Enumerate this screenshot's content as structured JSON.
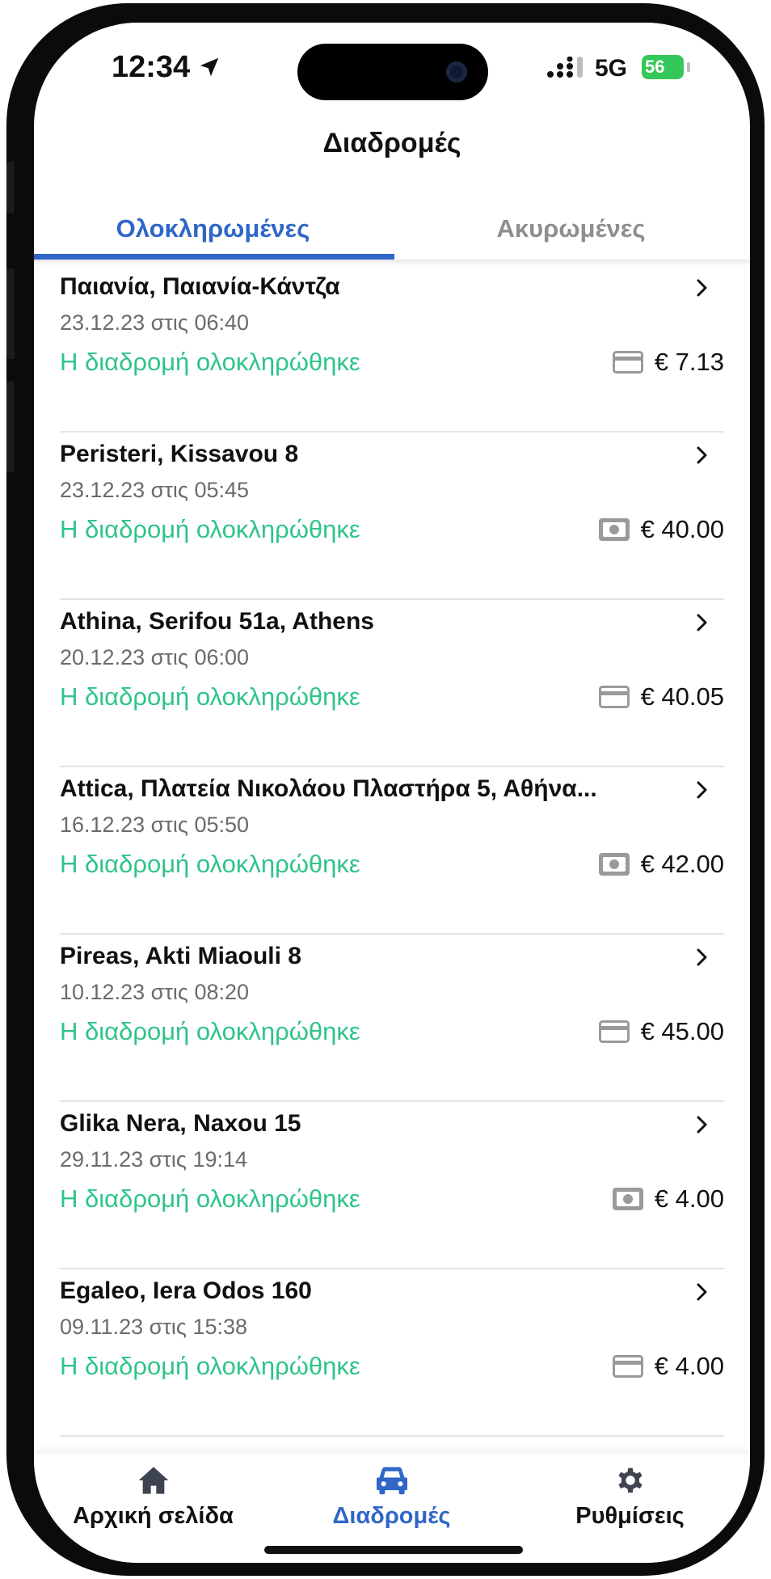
{
  "status_bar": {
    "time": "12:34",
    "network": "5G",
    "battery": "56"
  },
  "header": {
    "title": "Διαδρομές"
  },
  "tabs": [
    {
      "label": "Ολοκληρωμένες",
      "active": true
    },
    {
      "label": "Ακυρωμένες",
      "active": false
    }
  ],
  "trips": [
    {
      "address": "Παιανία, Παιανία-Κάντζα",
      "date": "23.12.23 στις 06:40",
      "status": "Η διαδρομή ολοκληρώθηκε",
      "price": "€ 7.13",
      "payment": "card"
    },
    {
      "address": "Peristeri, Kissavou 8",
      "date": "23.12.23 στις 05:45",
      "status": "Η διαδρομή ολοκληρώθηκε",
      "price": "€ 40.00",
      "payment": "cash"
    },
    {
      "address": "Athina, Serifou 51a, Athens",
      "date": "20.12.23 στις 06:00",
      "status": "Η διαδρομή ολοκληρώθηκε",
      "price": "€ 40.05",
      "payment": "card"
    },
    {
      "address": "Attica, Πλατεία Νικολάου Πλαστήρα 5, Αθήνα...",
      "date": "16.12.23 στις 05:50",
      "status": "Η διαδρομή ολοκληρώθηκε",
      "price": "€ 42.00",
      "payment": "cash"
    },
    {
      "address": "Pireas, Akti Miaouli 8",
      "date": "10.12.23 στις 08:20",
      "status": "Η διαδρομή ολοκληρώθηκε",
      "price": "€ 45.00",
      "payment": "card"
    },
    {
      "address": "Glika Nera, Naxou 15",
      "date": "29.11.23 στις 19:14",
      "status": "Η διαδρομή ολοκληρώθηκε",
      "price": "€ 4.00",
      "payment": "cash"
    },
    {
      "address": "Egaleo, Iera Odos 160",
      "date": "09.11.23 στις 15:38",
      "status": "Η διαδρομή ολοκληρώθηκε",
      "price": "€ 4.00",
      "payment": "card"
    }
  ],
  "bottom_nav": [
    {
      "label": "Αρχική σελίδα",
      "icon": "home-icon",
      "active": false
    },
    {
      "label": "Διαδρομές",
      "icon": "car-icon",
      "active": true
    },
    {
      "label": "Ρυθμίσεις",
      "icon": "gear-icon",
      "active": false
    }
  ],
  "colors": {
    "accent": "#2f66c8",
    "success": "#2fc48a",
    "muted": "#8e8e8e"
  }
}
